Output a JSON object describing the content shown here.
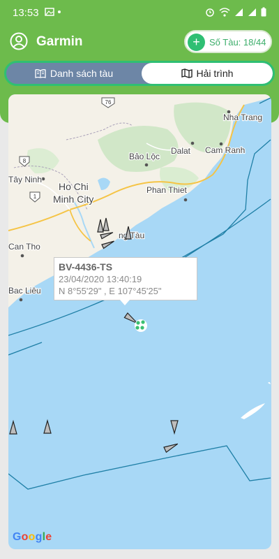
{
  "status_bar": {
    "time": "13:53"
  },
  "header": {
    "title": "Garmin",
    "vessel_count": "Số Tàu: 18/44"
  },
  "tabs": [
    {
      "label": "Danh sách tàu",
      "active": false
    },
    {
      "label": "Hải trình",
      "active": true
    }
  ],
  "map": {
    "labels": {
      "road_76": "76",
      "road_8": "8",
      "road_1": "1",
      "nha_trang": "Nha Trang",
      "bao_loc": "Bảo Lộc",
      "dalat": "Dalat",
      "cam_ranh": "Cam Ranh",
      "tay_ninh": "Tây Ninh",
      "hcm_1": "Ho Chi",
      "hcm_2": "Minh City",
      "phan_thiet": "Phan Thiet",
      "vung_tau": "ng Tàu",
      "can_tho": "Can Tho",
      "bac_lieu": "Bac Liêu"
    },
    "popup": {
      "vessel_id": "BV-4436-TS",
      "timestamp": "23/04/2020 13:40:19",
      "coordinates": "N 8°55'29\" , E 107°45'25\""
    },
    "attribution": "Google"
  },
  "colors": {
    "accent_green": "#6dbb4c",
    "teal": "#2fbf73",
    "sea": "#a8d8f6",
    "land": "#f5f2ea"
  }
}
